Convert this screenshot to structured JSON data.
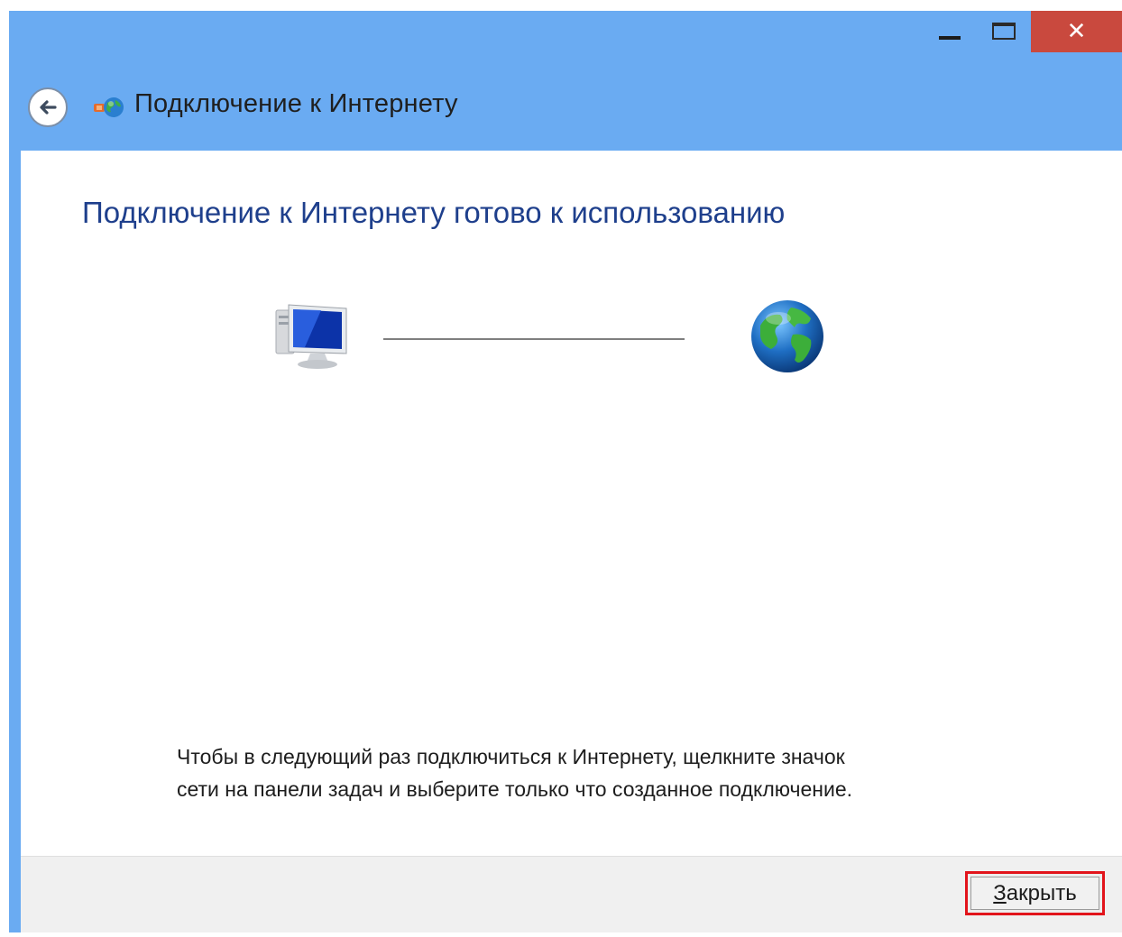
{
  "window": {
    "title": "Подключение к Интернету",
    "caption_buttons": {
      "minimize_icon": "minimize-icon",
      "maximize_icon": "maximize-icon",
      "close_glyph": "✕"
    },
    "title_bar_color": "#6aabf2",
    "close_button_color": "#c9493e"
  },
  "main": {
    "heading": "Подключение к Интернету готово к использованию",
    "diagram": {
      "left_icon": "computer-icon",
      "right_icon": "globe-icon"
    },
    "info_line_1": "Чтобы в следующий раз подключиться к Интернету, щелкните значок",
    "info_line_2": "сети на панели задач и выберите только что созданное подключение."
  },
  "footer": {
    "close_accel": "З",
    "close_rest": "акрыть",
    "highlight_color": "#e2141b"
  }
}
